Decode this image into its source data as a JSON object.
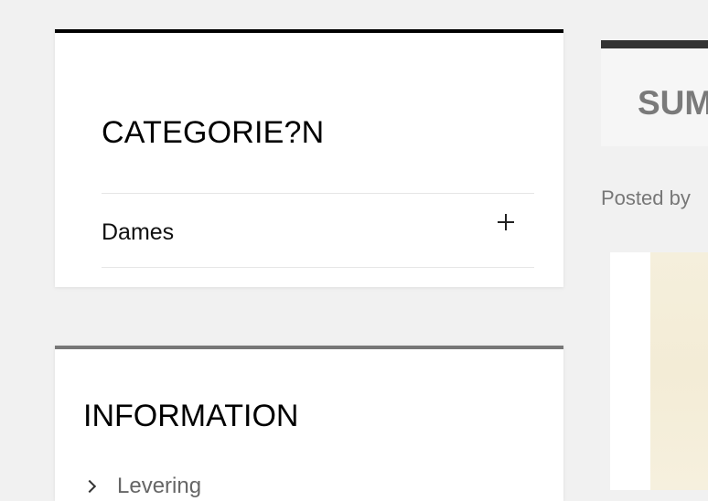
{
  "categories": {
    "title": "CATEGORIE?N",
    "items": [
      {
        "label": "Dames"
      }
    ]
  },
  "information": {
    "title": "INFORMATION",
    "items": [
      {
        "label": "Levering"
      }
    ]
  },
  "post": {
    "title": "SUM",
    "posted_by": "Posted by"
  },
  "colors": {
    "background": "#f1f1f1",
    "panel": "#ffffff",
    "categories_border": "#000000",
    "information_border": "#777777",
    "post_header_border": "#333333"
  },
  "icons": {
    "expand": "plus-icon",
    "bullet": "chevron-right-icon"
  }
}
